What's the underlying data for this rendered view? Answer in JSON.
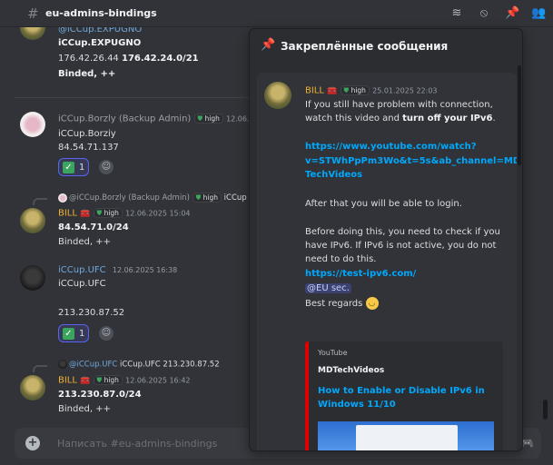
{
  "header": {
    "channel": "eu-admins-bindings",
    "icons": [
      "threads-icon",
      "mute-icon",
      "pin-icon",
      "members-icon"
    ]
  },
  "messages": {
    "m0": {
      "author": "@iCCup.EXPUGNO",
      "line1": "iCCup.EXPUGNO",
      "line2_a": "176.42.26.44 ",
      "line2_b": "176.42.24.0/21",
      "line3": "Binded, ++"
    },
    "m1": {
      "author": "iCCup.Borzly (Backup Admin)",
      "badge": "high",
      "time": "12.06.2",
      "line1": "iCCup.Borziy",
      "line2": "84.54.71.137",
      "reaction_count": "1"
    },
    "m2": {
      "reply_author": "@iCCup.Borzly (Backup Admin)",
      "reply_badge": "high",
      "reply_text": "iCCup",
      "author": "BILL",
      "badge": "high",
      "time": "12.06.2025 15:04",
      "line1": "84.54.71.0/24",
      "line2": "Binded, ++"
    },
    "m3": {
      "author": "iCCup.UFC",
      "time": "12.06.2025 16:38",
      "line1": "iCCup.UFC",
      "line2": "213.230.87.52",
      "reaction_count": "1"
    },
    "m4": {
      "reply_author": "@iCCup.UFC",
      "reply_text": "iCCup.UFC  213.230.87.52",
      "author": "BILL",
      "badge": "high",
      "time": "12.06.2025 16:42",
      "line1": "213.230.87.0/24",
      "line2": "Binded, ++"
    }
  },
  "composer": {
    "placeholder": "Написать #eu-admins-bindings"
  },
  "pinned": {
    "title": "Закреплённые сообщения",
    "msg": {
      "author": "BILL",
      "badge": "high",
      "time": "25.01.2025 22:03",
      "p1_a": "If you still have problem with connection,",
      "p1_b": "watch this video and ",
      "p1_c": "turn off your IPv6",
      "p1_d": ".",
      "link1": "https://www.youtube.com/watch?",
      "link2": "v=STWhPpPm3Wo&t=5s&ab_channel=MD",
      "link3": "TechVideos",
      "p2": "After that you will be able to login.",
      "p3_a": "Before doing this, you need to check if you",
      "p3_b": "have IPv6. If IPv6 is not active, you do not",
      "p3_c": "need to do this.",
      "link4": "https://test-ipv6.com/",
      "mention": "@EU sec.",
      "regards": "Best regards"
    },
    "embed": {
      "provider": "YouTube",
      "author": "MDTechVideos",
      "title": "How to Enable or Disable IPv6 in Windows 11/10"
    }
  },
  "colors": {
    "bg": "#313338",
    "panel": "#2b2d31",
    "link": "#00a8fc",
    "bill": "#f0b232",
    "ufc": "#6fa8dc",
    "youtube": "#e10000"
  }
}
